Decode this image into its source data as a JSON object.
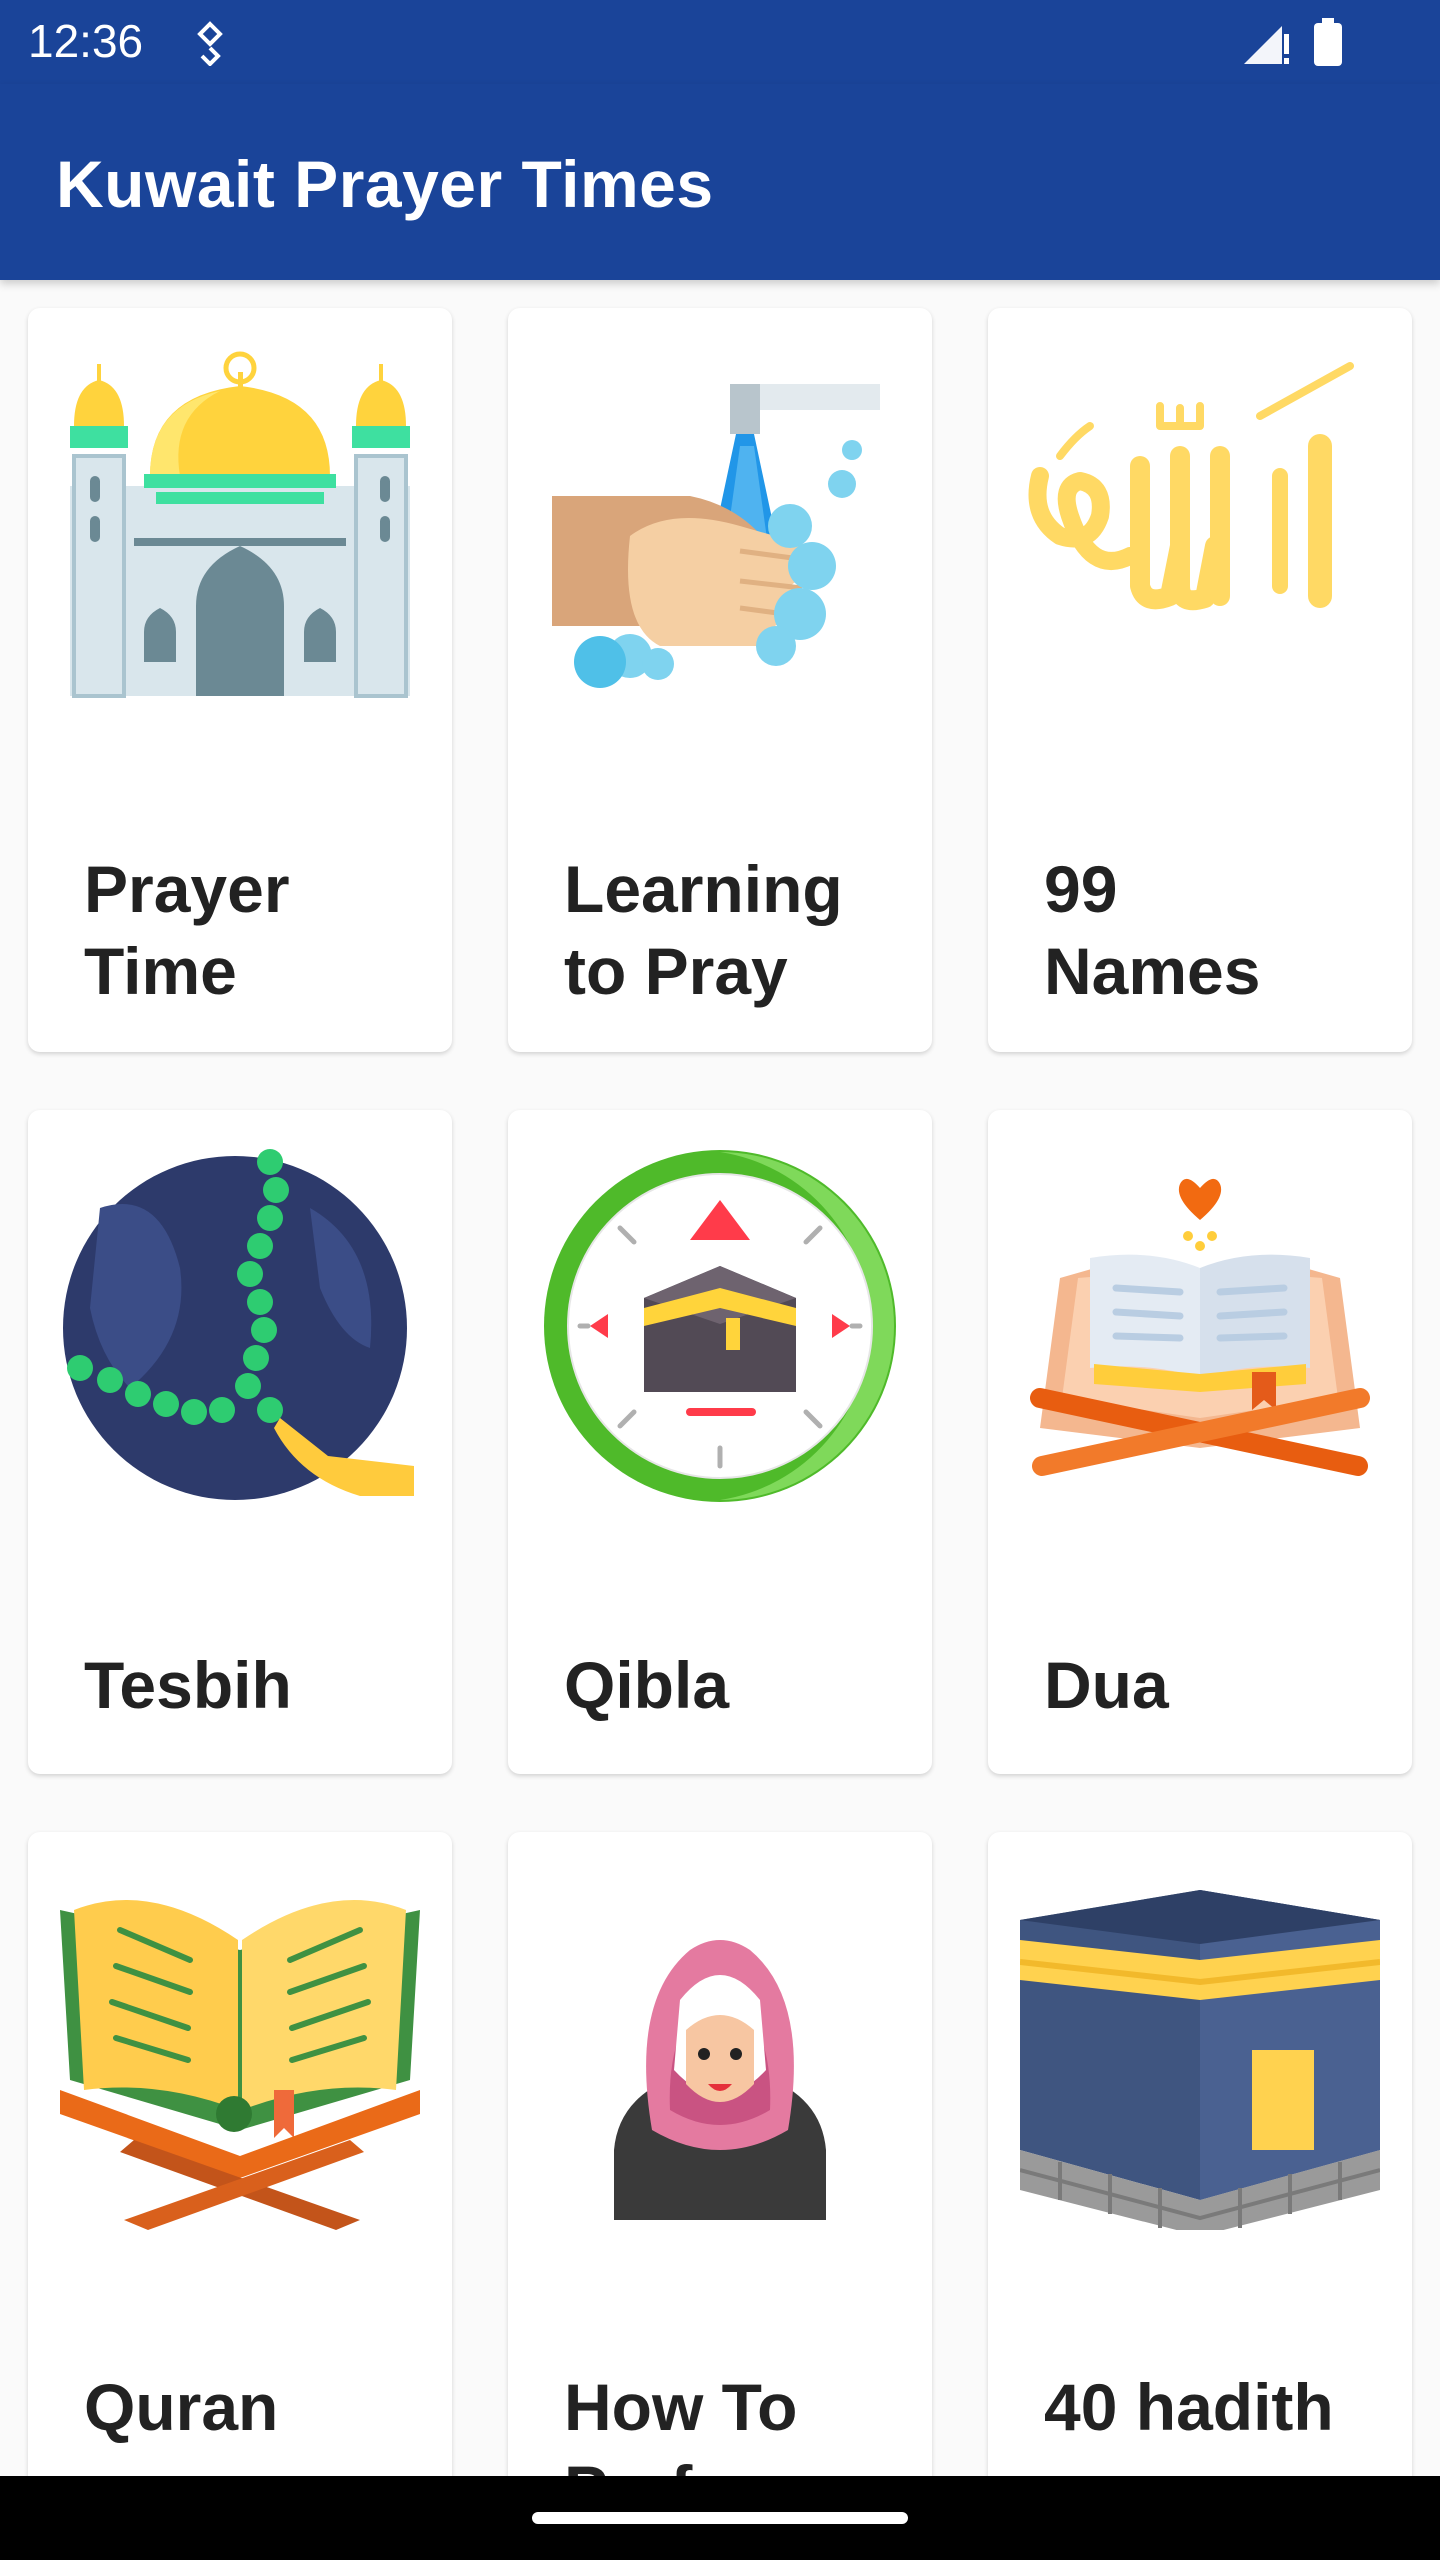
{
  "status_bar": {
    "time": "12:36",
    "icons": [
      "location-icon",
      "signal-icon",
      "battery-icon"
    ]
  },
  "app_bar": {
    "title": "Kuwait Prayer Times",
    "color": "#1a4499"
  },
  "menu": [
    {
      "label": "Prayer\nTime",
      "icon": "mosque-icon"
    },
    {
      "label": "Learning\nto Pray",
      "icon": "wudu-hands-icon"
    },
    {
      "label": "99\nNames",
      "icon": "allah-calligraphy-icon"
    },
    {
      "label": "Tesbih",
      "icon": "prayer-beads-icon"
    },
    {
      "label": "Qibla",
      "icon": "qibla-compass-icon"
    },
    {
      "label": "Dua",
      "icon": "open-book-heart-icon"
    },
    {
      "label": "Quran",
      "icon": "quran-book-icon"
    },
    {
      "label": "How To\nPerform",
      "icon": "hijab-woman-icon"
    },
    {
      "label": "40 hadith",
      "icon": "kaaba-icon"
    }
  ]
}
